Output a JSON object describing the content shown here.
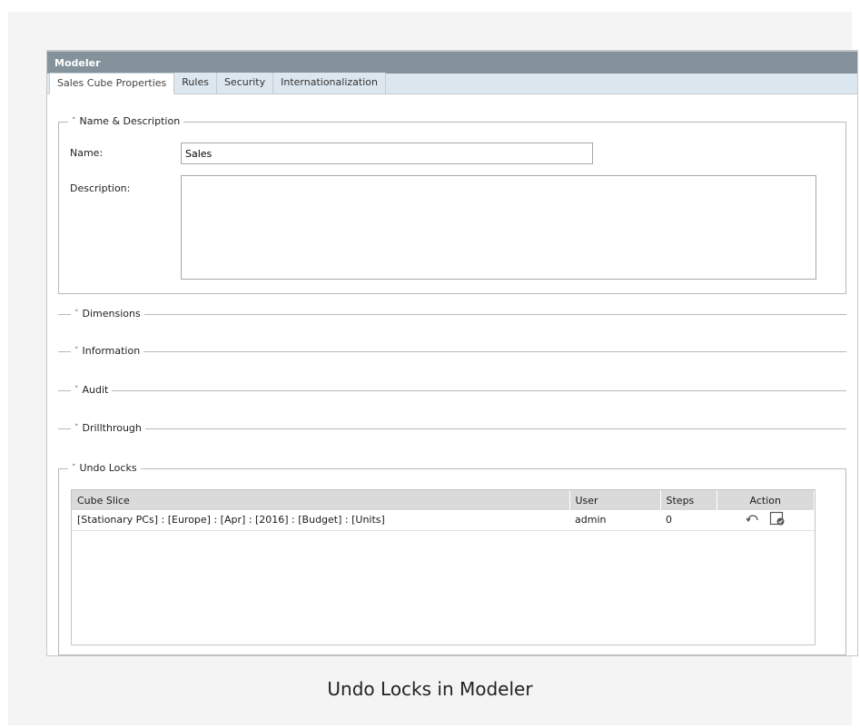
{
  "window": {
    "title": "Modeler"
  },
  "tabs": [
    {
      "label": "Sales Cube Properties",
      "active": true
    },
    {
      "label": "Rules",
      "active": false
    },
    {
      "label": "Security",
      "active": false
    },
    {
      "label": "Internationalization",
      "active": false
    }
  ],
  "name_description": {
    "legend": "Name & Description",
    "expanded": true,
    "name_label": "Name:",
    "name_value": "Sales",
    "description_label": "Description:",
    "description_value": ""
  },
  "collapsed_sections": [
    {
      "label": "Dimensions",
      "expanded": false
    },
    {
      "label": "Information",
      "expanded": false
    },
    {
      "label": "Audit",
      "expanded": false
    },
    {
      "label": "Drillthrough",
      "expanded": false
    }
  ],
  "undo_locks": {
    "legend": "Undo Locks",
    "expanded": true,
    "columns": [
      "Cube Slice",
      "User",
      "Steps",
      "Action"
    ],
    "rows": [
      {
        "cube_slice": "[Stationary PCs] : [Europe] : [Apr] : [2016] : [Budget] : [Units]",
        "user": "admin",
        "steps": "0",
        "actions": [
          "undo-icon",
          "commit-icon"
        ]
      }
    ]
  },
  "caption": "Undo Locks in Modeler",
  "colors": {
    "titlebar": "#84939b",
    "tabstrip": "#dde7ef",
    "table_header": "#dadada"
  }
}
